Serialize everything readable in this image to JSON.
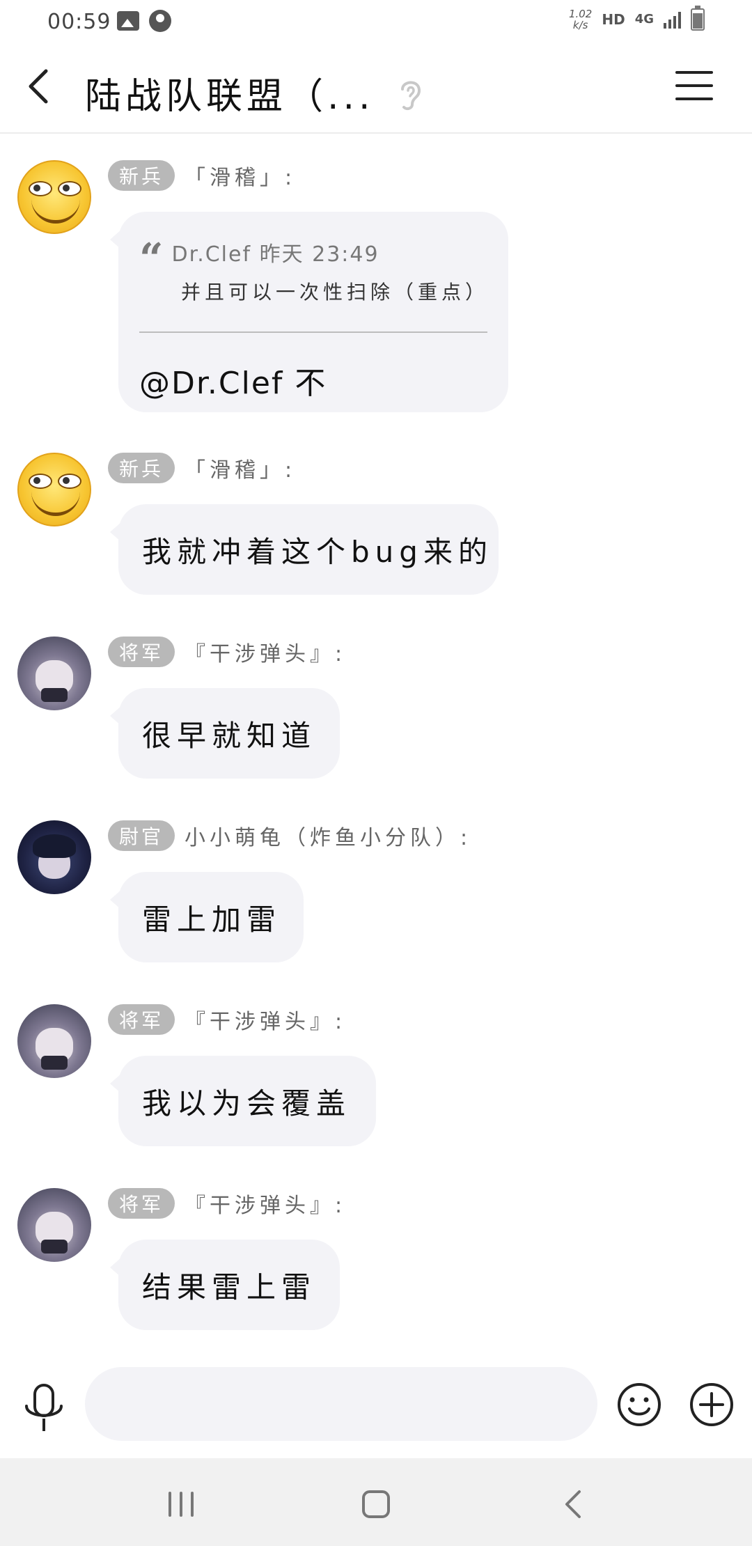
{
  "status_bar": {
    "time": "00:59",
    "speed_top": "1.02",
    "speed_bottom": "k/s",
    "hd": "HD",
    "network": "4G"
  },
  "header": {
    "title": "陆战队联盟（...",
    "back_icon": "back-arrow-icon",
    "ear_icon": "ear-icon",
    "menu_icon": "menu-icon"
  },
  "messages": [
    {
      "rank": "新兵",
      "sender": "「滑稽」:",
      "avatar": "funny-face-emoji",
      "quote": {
        "author_time": "Dr.Clef 昨天 23:49",
        "text": "并且可以一次性扫除（重点）"
      },
      "text": "@Dr.Clef 不"
    },
    {
      "rank": "新兵",
      "sender": "「滑稽」:",
      "avatar": "funny-face-emoji",
      "text": "我就冲着这个bug来的"
    },
    {
      "rank": "将军",
      "sender": "『干涉弹头』:",
      "avatar": "anime-white-hair",
      "text": "很早就知道"
    },
    {
      "rank": "尉官",
      "sender": "小小萌龟（炸鱼小分队）:",
      "avatar": "anime-dark-hair",
      "text": "雷上加雷"
    },
    {
      "rank": "将军",
      "sender": "『干涉弹头』:",
      "avatar": "anime-white-hair",
      "text": "我以为会覆盖"
    },
    {
      "rank": "将军",
      "sender": "『干涉弹头』:",
      "avatar": "anime-white-hair",
      "text": "结果雷上雷"
    }
  ],
  "input_bar": {
    "value": "",
    "mic_icon": "microphone-icon",
    "emoji_icon": "smiley-icon",
    "plus_icon": "plus-icon"
  },
  "nav_bar": {
    "recent_icon": "recent-apps-icon",
    "home_icon": "home-icon",
    "back_icon": "back-icon"
  },
  "colors": {
    "bubble": "#f3f3f7",
    "badge": "#b8b8b8",
    "sender": "#666666",
    "navbar": "#f1f1f1"
  }
}
